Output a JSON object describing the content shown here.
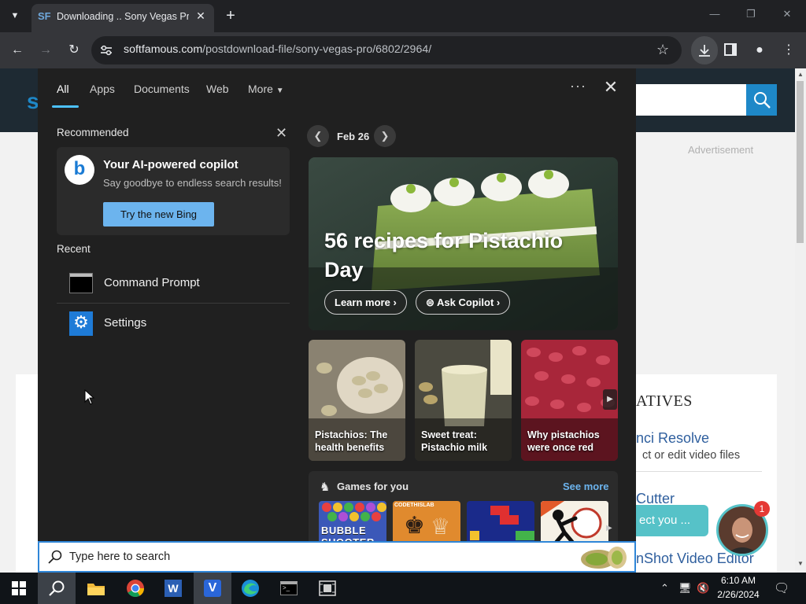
{
  "browser": {
    "tab_title": "Downloading .. Sony Vegas Pro",
    "tab_favicon": "SF",
    "url_host": "softfamous.com",
    "url_path": "/postdownload-file/sony-vegas-pro/6802/2964/"
  },
  "site": {
    "advertisement": "Advertisement",
    "alternatives_title": "ATIVES",
    "alt_items": [
      {
        "title": "nci Resolve",
        "desc": "ct or edit video files"
      },
      {
        "title": "Cutter"
      },
      {
        "title": "nShot Video Editor"
      }
    ],
    "chat_text": "ect you ...",
    "chat_badge": "1"
  },
  "search_panel": {
    "tabs": {
      "all": "All",
      "apps": "Apps",
      "documents": "Documents",
      "web": "Web",
      "more": "More"
    },
    "dots": "···",
    "recommended_label": "Recommended",
    "copilot": {
      "title": "Your AI-powered copilot",
      "subtitle": "Say goodbye to endless search results!",
      "button": "Try the new Bing"
    },
    "recent_label": "Recent",
    "recent": [
      {
        "label": "Command Prompt",
        "icon": "command-prompt-icon"
      },
      {
        "label": "Settings",
        "icon": "settings-gear-icon"
      }
    ],
    "date": "Feb 26",
    "hero": {
      "title": "56 recipes for Pistachio Day",
      "learn_more": "Learn more",
      "ask_copilot": "Ask Copilot"
    },
    "tiles": [
      {
        "caption": "Pistachios: The health benefits"
      },
      {
        "caption": "Sweet treat: Pistachio milk"
      },
      {
        "caption": "Why pistachios were once red"
      }
    ],
    "games": {
      "label": "Games for you",
      "see_more": "See more",
      "items": [
        "BUBBLE SHOOTER",
        "CODETHISLAB",
        "",
        ""
      ]
    }
  },
  "search_box": {
    "placeholder": "Type here to search"
  },
  "taskbar": {
    "time": "6:10 AM",
    "date": "2/26/2024"
  },
  "colors": {
    "accent": "#4cc2ff",
    "bing_button": "#6cb4ee",
    "site_search": "#1e88c8"
  }
}
